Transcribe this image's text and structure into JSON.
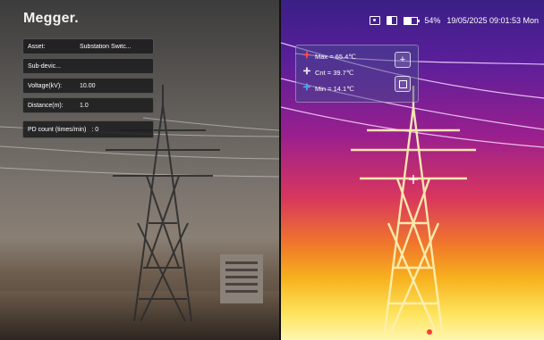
{
  "brand": {
    "logo": "Megger."
  },
  "status": {
    "battery_percent": "54%",
    "battery_level": 0.54,
    "datetime": "19/05/2025 09:01:53 Mon",
    "icons": [
      "camera-icon",
      "view-split-icon",
      "battery-icon"
    ]
  },
  "info": {
    "asset": {
      "label": "Asset:",
      "value": "Substation Switc..."
    },
    "sub_device": {
      "label": "Sub-devic..."
    },
    "voltage": {
      "label": "Voltage(kV):",
      "value": "10.00"
    },
    "distance": {
      "label": "Distance(m):",
      "value": "1.0"
    },
    "pd": {
      "label": "PD count (times/min)",
      "value": ": 0"
    }
  },
  "temps": {
    "max": {
      "label": "Max = 65.4℃",
      "color": "#ff4f4f"
    },
    "cnt": {
      "label": "Cnt = 39.7℃",
      "color": "#ffffff"
    },
    "min": {
      "label": "Min = 14.1℃",
      "color": "#4fb3ff"
    },
    "buttons": {
      "add": "+"
    }
  }
}
